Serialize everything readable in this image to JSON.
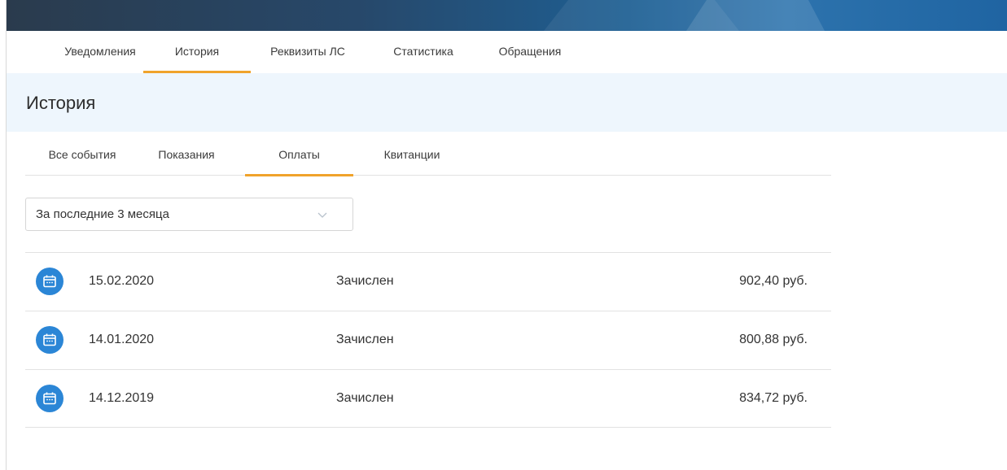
{
  "main_tabs": [
    {
      "label": "Уведомления",
      "active": false
    },
    {
      "label": "История",
      "active": true
    },
    {
      "label": "Реквизиты ЛС",
      "active": false
    },
    {
      "label": "Статистика",
      "active": false
    },
    {
      "label": "Обращения",
      "active": false
    }
  ],
  "page": {
    "title": "История"
  },
  "sub_tabs": [
    {
      "label": "Все события",
      "active": false
    },
    {
      "label": "Показания",
      "active": false
    },
    {
      "label": "Оплаты",
      "active": true
    },
    {
      "label": "Квитанции",
      "active": false
    }
  ],
  "filter": {
    "selected": "За последние 3 месяца",
    "icon": "chevron-down-icon"
  },
  "payments": [
    {
      "date": "15.02.2020",
      "status": "Зачислен",
      "amount": "902,40 руб.",
      "icon": "calendar-icon"
    },
    {
      "date": "14.01.2020",
      "status": "Зачислен",
      "amount": "800,88 руб.",
      "icon": "calendar-icon"
    },
    {
      "date": "14.12.2019",
      "status": "Зачислен",
      "amount": "834,72 руб.",
      "icon": "calendar-icon"
    }
  ],
  "colors": {
    "accent": "#f0a32b",
    "icon_blue": "#2b86d6",
    "title_bg": "#eef6fd"
  }
}
